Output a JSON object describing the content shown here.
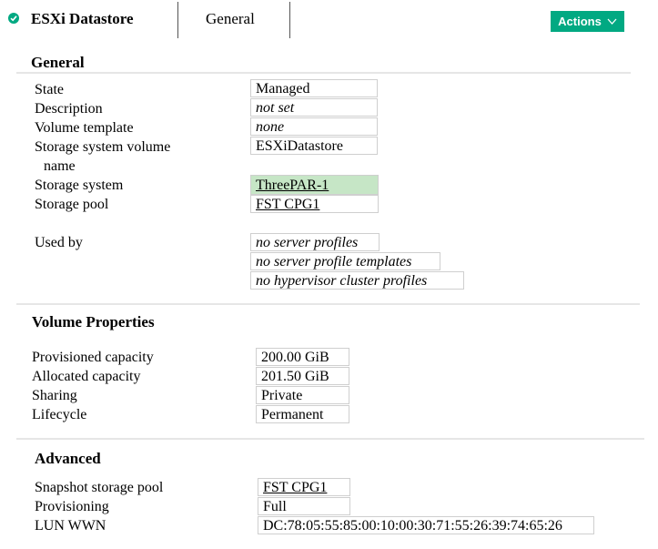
{
  "header": {
    "title": "ESXi Datastore",
    "tab": "General",
    "actions_label": "Actions"
  },
  "colors": {
    "accent": "#01a982",
    "highlight": "#c6e6c6"
  },
  "general": {
    "title": "General",
    "rows": [
      {
        "label": "State",
        "value": "Managed"
      },
      {
        "label": "Description",
        "value": "not set"
      },
      {
        "label": "Volume template",
        "value": "none"
      },
      {
        "label": "Storage system volume",
        "label2": "name",
        "value": "ESXiDatastore"
      },
      {
        "label": "Storage system",
        "value": "ThreePAR-1"
      },
      {
        "label": "Storage pool",
        "value": "FST CPG1"
      }
    ],
    "used_by": {
      "label": "Used by",
      "values": [
        "no server profiles",
        "no server profile templates",
        "no hypervisor cluster profiles"
      ]
    }
  },
  "volume": {
    "title": "Volume Properties",
    "rows": [
      {
        "label": "Provisioned capacity",
        "value": "200.00 GiB"
      },
      {
        "label": "Allocated capacity",
        "value": "201.50 GiB"
      },
      {
        "label": "Sharing",
        "value": "Private"
      },
      {
        "label": "Lifecycle",
        "value": "Permanent"
      }
    ]
  },
  "advanced": {
    "title": "Advanced",
    "rows": [
      {
        "label": "Snapshot storage pool",
        "value": "FST CPG1"
      },
      {
        "label": "Provisioning",
        "value": "Full"
      },
      {
        "label": "LUN WWN",
        "value": "DC:78:05:55:85:00:10:00:30:71:55:26:39:74:65:26"
      }
    ]
  }
}
